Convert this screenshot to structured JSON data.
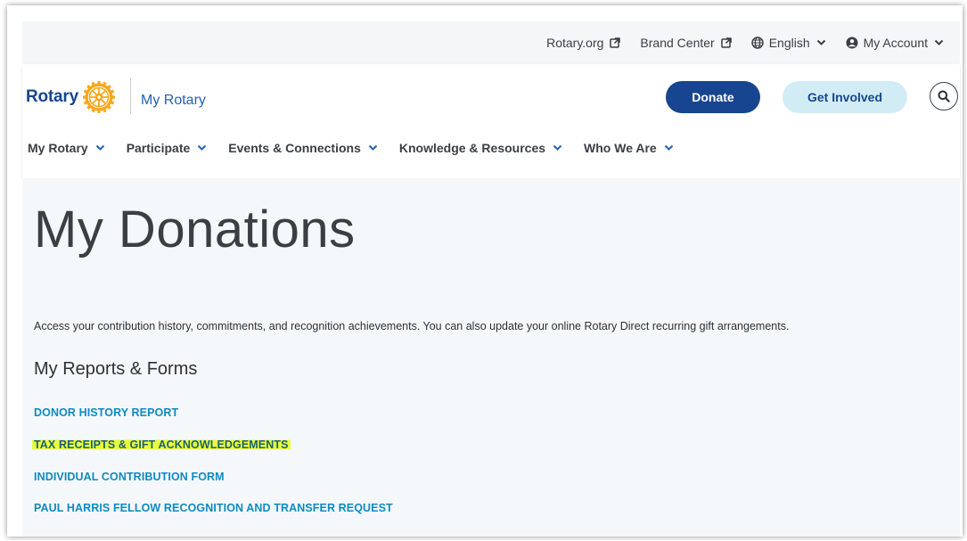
{
  "utility": {
    "rotary_org": "Rotary.org",
    "brand_center": "Brand Center",
    "language": "English",
    "account": "My Account"
  },
  "header": {
    "logo_text": "Rotary",
    "site_title": "My Rotary",
    "donate_label": "Donate",
    "involved_label": "Get Involved"
  },
  "nav": {
    "items": [
      {
        "label": "My Rotary"
      },
      {
        "label": "Participate"
      },
      {
        "label": "Events & Connections"
      },
      {
        "label": "Knowledge & Resources"
      },
      {
        "label": "Who We Are"
      }
    ]
  },
  "main": {
    "title": "My Donations",
    "intro": "Access your contribution history, commitments, and recognition achievements. You can also update your online Rotary Direct recurring gift arrangements.",
    "section_title": "My Reports & Forms",
    "links": [
      {
        "label": "DONOR HISTORY REPORT"
      },
      {
        "label": "TAX RECEIPTS & GIFT ACKNOWLEDGEMENTS",
        "highlighted": true
      },
      {
        "label": "INDIVIDUAL CONTRIBUTION FORM"
      },
      {
        "label": "PAUL HARRIS FELLOW RECOGNITION AND TRANSFER REQUEST"
      }
    ]
  },
  "icons": {
    "external": "external-link-icon",
    "globe": "globe-icon",
    "account": "user-circle-icon",
    "chevron": "chevron-down-icon",
    "search": "search-icon",
    "logo": "rotary-wheel-icon"
  },
  "colors": {
    "brand_blue": "#17458f",
    "link_blue": "#0e8ac2",
    "gold": "#f7a81b",
    "highlight": "#e6ff28"
  }
}
